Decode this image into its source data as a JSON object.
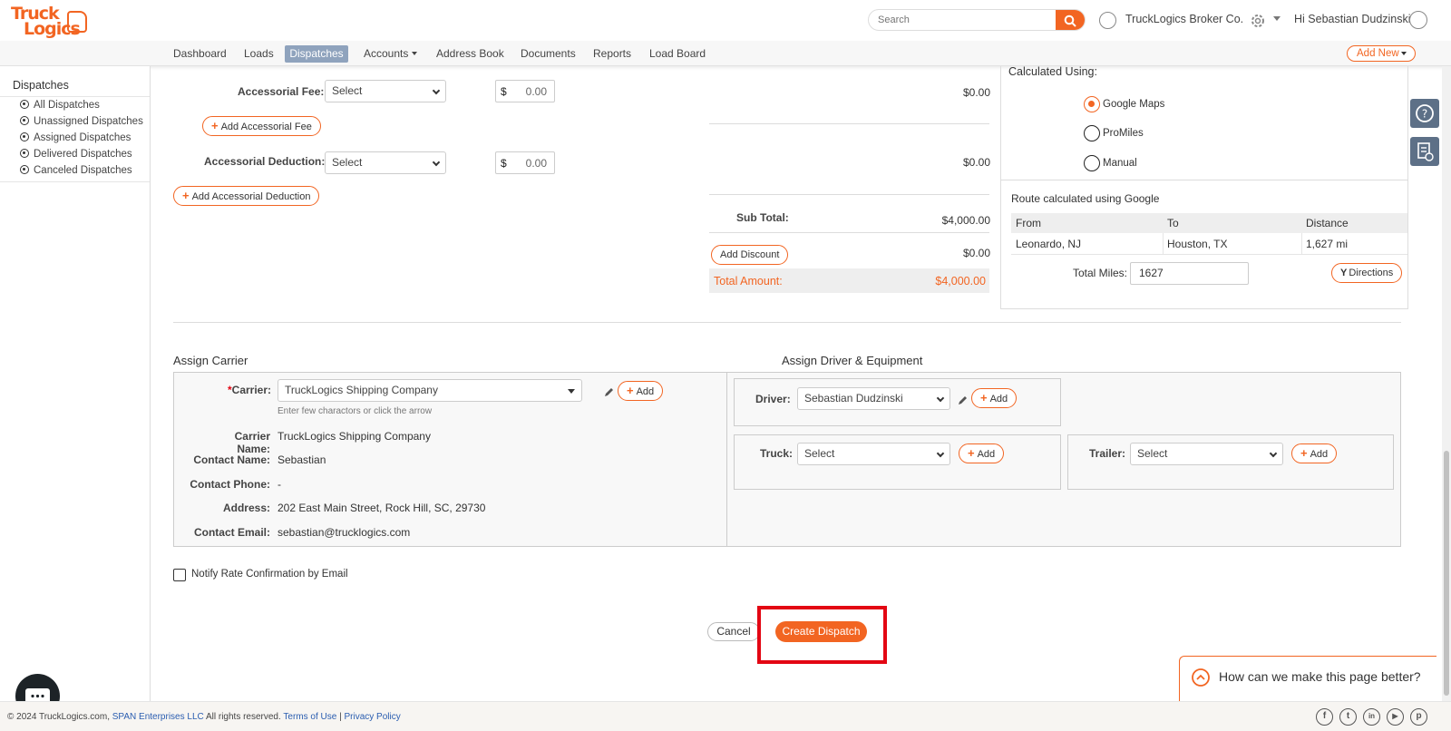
{
  "brand": {
    "logo_line1": "Truck",
    "logo_line2": "Logics"
  },
  "header": {
    "search_placeholder": "Search",
    "company": "TruckLogics Broker Co.",
    "greeting": "Hi Sebastian Dudzinski"
  },
  "nav": {
    "items": [
      "Dashboard",
      "Loads",
      "Dispatches",
      "Accounts",
      "Address Book",
      "Documents",
      "Reports",
      "Load Board"
    ],
    "active": "Dispatches",
    "add_new": "Add New"
  },
  "sidebar": {
    "title": "Dispatches",
    "items": [
      "All Dispatches",
      "Unassigned Dispatches",
      "Assigned Dispatches",
      "Delivered Dispatches",
      "Canceled Dispatches"
    ]
  },
  "charges": {
    "accessorial_fee_label": "Accessorial Fee:",
    "accessorial_fee_select": "Select",
    "accessorial_fee_currency": "$",
    "accessorial_fee_amount": "0.00",
    "accessorial_fee_value": "$0.00",
    "add_accessorial_fee": "Add Accessorial Fee",
    "accessorial_deduction_label": "Accessorial Deduction:",
    "accessorial_deduction_select": "Select",
    "accessorial_deduction_currency": "$",
    "accessorial_deduction_amount": "0.00",
    "accessorial_deduction_value": "$0.00",
    "add_accessorial_deduction": "Add Accessorial Deduction",
    "subtotal_label": "Sub Total:",
    "subtotal_value": "$4,000.00",
    "add_discount": "Add Discount",
    "discount_value": "$0.00",
    "total_label": "Total Amount:",
    "total_value": "$4,000.00"
  },
  "route": {
    "calculated_using_label": "Calculated Using:",
    "options": [
      "Google Maps",
      "ProMiles",
      "Manual"
    ],
    "selected": "Google Maps",
    "route_note": "Route calculated using Google",
    "columns": [
      "From",
      "To",
      "Distance"
    ],
    "rows": [
      [
        "Leonardo, NJ",
        "Houston, TX",
        "1,627 mi"
      ]
    ],
    "total_miles_label": "Total Miles:",
    "total_miles_value": "1627",
    "directions": "Directions"
  },
  "carrier": {
    "section_title": "Assign Carrier",
    "required_mark": "*",
    "carrier_label": "Carrier:",
    "carrier_value": "TruckLogics Shipping Company",
    "hint": "Enter few charactors or click the arrow",
    "add": "Add",
    "fields": [
      {
        "label": "Carrier Name:",
        "value": "TruckLogics Shipping Company"
      },
      {
        "label": "Contact Name:",
        "value": "Sebastian"
      },
      {
        "label": "Contact Phone:",
        "value": "-"
      },
      {
        "label": "Address:",
        "value": "202 East Main Street, Rock Hill, SC, 29730"
      },
      {
        "label": "Contact Email:",
        "value": "sebastian@trucklogics.com"
      }
    ]
  },
  "driver": {
    "section_title": "Assign Driver & Equipment",
    "driver_label": "Driver:",
    "driver_value": "Sebastian Dudzinski",
    "truck_label": "Truck:",
    "truck_value": "Select",
    "trailer_label": "Trailer:",
    "trailer_value": "Select",
    "add": "Add"
  },
  "notify_label": "Notify Rate Confirmation by Email",
  "actions": {
    "cancel": "Cancel",
    "create": "Create Dispatch"
  },
  "feedback": "How can we make this page better?",
  "footer": {
    "copyright_prefix": "© 2024 TruckLogics.com,",
    "company_link": "SPAN Enterprises LLC",
    "rights": "All rights reserved.",
    "terms": "Terms of Use",
    "separator": "|",
    "privacy": "Privacy Policy",
    "social": [
      "f",
      "t",
      "in",
      "▶",
      "p"
    ]
  },
  "colors": {
    "accent": "#f26522",
    "nav_active": "#8fa3bd",
    "highlight": "#e30613"
  }
}
